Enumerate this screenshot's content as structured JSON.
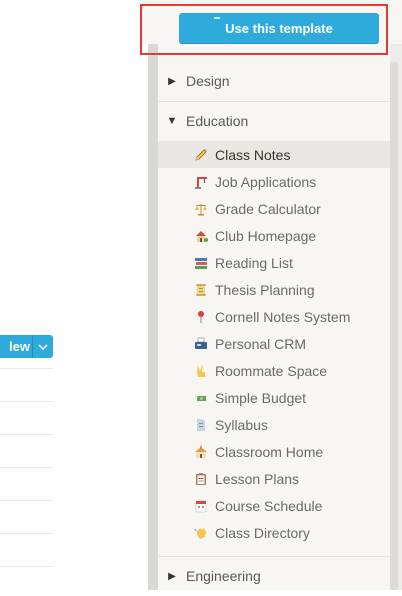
{
  "primary_button": {
    "label": "Use this template"
  },
  "background_page": {
    "new_button_label": "lew"
  },
  "sections": [
    {
      "label": "Design",
      "state": "collapsed"
    },
    {
      "label": "Education",
      "state": "expanded"
    },
    {
      "label": "Engineering",
      "state": "collapsed"
    }
  ],
  "education_items": [
    {
      "label": "Class Notes",
      "icon": "pencil-icon",
      "active": true
    },
    {
      "label": "Job Applications",
      "icon": "crane-icon"
    },
    {
      "label": "Grade Calculator",
      "icon": "scales-icon"
    },
    {
      "label": "Club Homepage",
      "icon": "house-garden-icon"
    },
    {
      "label": "Reading List",
      "icon": "books-icon"
    },
    {
      "label": "Thesis Planning",
      "icon": "scroll-icon"
    },
    {
      "label": "Cornell Notes System",
      "icon": "pushpin-icon"
    },
    {
      "label": "Personal CRM",
      "icon": "fax-icon"
    },
    {
      "label": "Roommate Space",
      "icon": "victory-hand-icon"
    },
    {
      "label": "Simple Budget",
      "icon": "money-wings-icon"
    },
    {
      "label": "Syllabus",
      "icon": "page-icon"
    },
    {
      "label": "Classroom Home",
      "icon": "school-icon"
    },
    {
      "label": "Lesson Plans",
      "icon": "clipboard-icon"
    },
    {
      "label": "Course Schedule",
      "icon": "calendar-icon"
    },
    {
      "label": "Class Directory",
      "icon": "wave-hand-icon"
    }
  ],
  "colors": {
    "accent": "#2eaadc",
    "highlight_border": "#e53935",
    "panel_bg": "#f7f6f3",
    "active_row": "#e8e7e4"
  }
}
